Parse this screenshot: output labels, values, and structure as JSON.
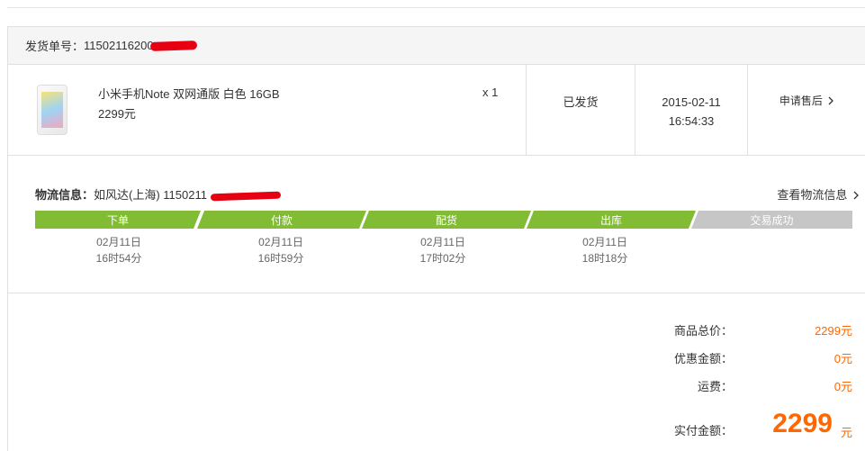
{
  "shipment": {
    "label": "发货单号：",
    "number_visible": "11502116200"
  },
  "product": {
    "name": "小米手机Note 双网通版 白色 16GB",
    "price": "2299元",
    "qty": "x 1",
    "status": "已发货",
    "date": "2015-02-11",
    "time": "16:54:33",
    "after_sale": "申请售后"
  },
  "logistics": {
    "label": "物流信息：",
    "carrier": "如风达(上海) 1150211",
    "view_link": "查看物流信息",
    "steps": [
      {
        "label": "下单",
        "date": "02月11日",
        "time": "16时54分",
        "done": true
      },
      {
        "label": "付款",
        "date": "02月11日",
        "time": "16时59分",
        "done": true
      },
      {
        "label": "配货",
        "date": "02月11日",
        "time": "17时02分",
        "done": true
      },
      {
        "label": "出库",
        "date": "02月11日",
        "time": "18时18分",
        "done": true
      },
      {
        "label": "交易成功",
        "date": "",
        "time": "",
        "done": false
      }
    ]
  },
  "summary": {
    "goods_label": "商品总价：",
    "goods_value": "2299元",
    "discount_label": "优惠金额：",
    "discount_value": "0元",
    "shipping_label": "运费：",
    "shipping_value": "0元",
    "paid_label": "实付金额：",
    "paid_value": "2299",
    "paid_unit": "元"
  },
  "colors": {
    "step_done": "#82bc35",
    "step_pending": "#c6c6c6",
    "price_accent": "#ff6700",
    "redaction": "#e60012"
  },
  "icons": {
    "chevron": "chevron-right-icon"
  }
}
